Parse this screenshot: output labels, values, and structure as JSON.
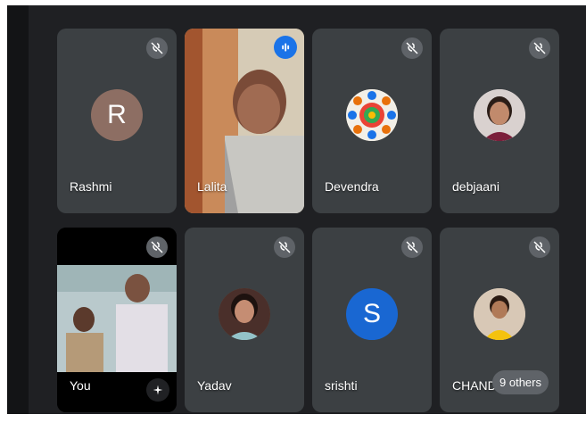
{
  "participants": [
    {
      "name": "Rashmi",
      "initial": "R",
      "avatar_color": "#8d6e63",
      "muted": true
    },
    {
      "name": "Lalita",
      "video": true,
      "speaking": true
    },
    {
      "name": "Devendra",
      "avatar": "mandala",
      "muted": true
    },
    {
      "name": "debjaani",
      "avatar": "photo",
      "muted": true
    },
    {
      "name": "You",
      "video": true,
      "muted": true
    },
    {
      "name": "Yadav",
      "avatar": "photo",
      "muted": true
    },
    {
      "name": "srishti",
      "initial": "S",
      "avatar_color": "#1967d2",
      "muted": true
    },
    {
      "name": "CHAND",
      "avatar": "photo",
      "muted": true
    }
  ],
  "others_chip": "9 others",
  "icons": {
    "mute": "mic-off-icon",
    "speaking": "audio-level-icon",
    "effects": "sparkle-icon"
  },
  "colors": {
    "stage_bg": "#1f2023",
    "tile_bg": "#3c4043",
    "accent": "#1a73e8"
  }
}
